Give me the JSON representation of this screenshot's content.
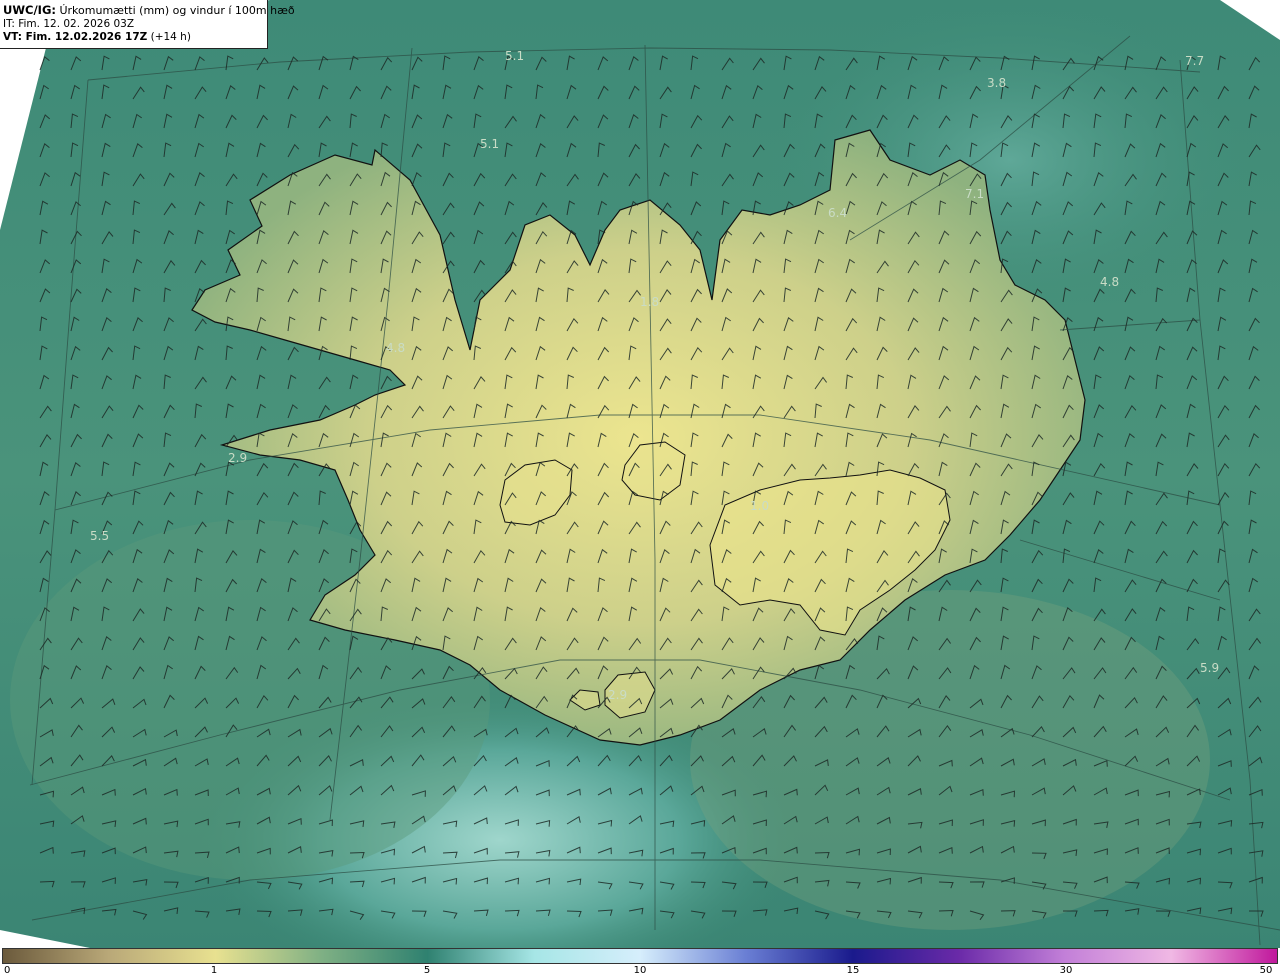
{
  "header": {
    "model_prefix": "UWC/IG:",
    "product_title": "Úrkomumætti (mm) og vindur í 100m hæð",
    "issue_time": "IT: Fim. 12. 02. 2026 03Z",
    "valid_prefix": "VT:",
    "valid_time": "Fim. 12.02.2026 17Z",
    "lead_time": "(+14 h)"
  },
  "map": {
    "region": "Iceland",
    "background_color": "#3f8c78",
    "land_color_high": "#e6e08a",
    "coast_color": "#111111",
    "point_values": [
      {
        "id": "nw-sea-north",
        "text": "5.1"
      },
      {
        "id": "north-sea-mid",
        "text": "5.1"
      },
      {
        "id": "ne-sea",
        "text": "3.8"
      },
      {
        "id": "far-ne",
        "text": "7.7"
      },
      {
        "id": "northeast-coast",
        "text": "6.4"
      },
      {
        "id": "langanes",
        "text": "7.1"
      },
      {
        "id": "east-sea",
        "text": "4.8"
      },
      {
        "id": "westfjords-south",
        "text": "4.8"
      },
      {
        "id": "snaefellsnes",
        "text": "2.9"
      },
      {
        "id": "west-sea",
        "text": "5.5"
      },
      {
        "id": "south-highlands",
        "text": "1.0"
      },
      {
        "id": "north-interior",
        "text": "1.8"
      },
      {
        "id": "westman-islands",
        "text": "2.9"
      },
      {
        "id": "southeast-sea",
        "text": "5.9"
      }
    ]
  },
  "colorbar": {
    "ticks": [
      "0",
      "1",
      "5",
      "10",
      "15",
      "30",
      "50"
    ],
    "colors": [
      "#6b5a3c",
      "#b9a878",
      "#e8e190",
      "#7fb084",
      "#2f8170",
      "#a6e6e6",
      "#d6eefc",
      "#6a7fd4",
      "#1a1a8c",
      "#6a2aa8",
      "#c27fd8",
      "#f0b8e4",
      "#c0189c"
    ]
  }
}
